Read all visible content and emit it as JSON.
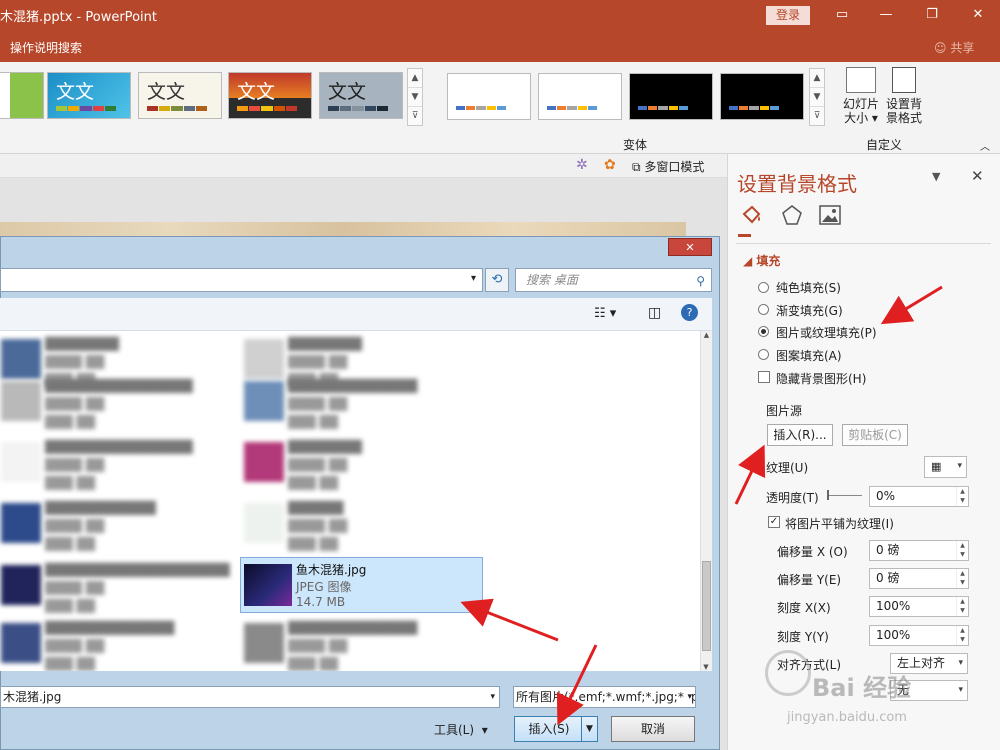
{
  "window": {
    "title": "木混猪.pptx - PowerPoint",
    "login_label": "登录",
    "tell_me": "操作说明搜索",
    "share": "共享"
  },
  "ribbon": {
    "theme_text": "文文",
    "theme_labels": [
      "文文",
      "文文",
      "文文",
      "文文"
    ],
    "variants_label": "变体",
    "customize_label": "自定义",
    "slide_size_label": "幻灯片大小",
    "slide_size_l1": "幻灯片",
    "slide_size_l2": "大小",
    "format_bg_l1": "设置背",
    "format_bg_l2": "景格式"
  },
  "viewbar": {
    "multiwindow": "多窗口模式"
  },
  "pane": {
    "title": "设置背景格式",
    "section_fill": "填充",
    "fill_options": [
      "纯色填充(S)",
      "渐变填充(G)",
      "图片或纹理填充(P)",
      "图案填充(A)"
    ],
    "selected_fill": "图片或纹理填充(P)",
    "hide_bg": "隐藏背景图形(H)",
    "picture_source": "图片源",
    "insert_btn": "插入(R)...",
    "clipboard_btn": "剪贴板(C)",
    "texture": "纹理(U)",
    "transparency": "透明度(T)",
    "transparency_value": "0%",
    "tile_as_texture": "将图片平铺为纹理(I)",
    "offset_x": "偏移量 X (O)",
    "offset_x_value": "0 磅",
    "offset_y": "偏移量 Y(E)",
    "offset_y_value": "0 磅",
    "scale_x": "刻度 X(X)",
    "scale_x_value": "100%",
    "scale_y": "刻度 Y(Y)",
    "scale_y_value": "100%",
    "align": "对齐方式(L)",
    "align_value": "左上对齐",
    "mirror_value": "无"
  },
  "dialog": {
    "search_placeholder": "搜索 桌面",
    "selected_file": {
      "name": "鱼木混猪.jpg",
      "type": "JPEG 图像",
      "size": "14.7 MB"
    },
    "filename_value": "木混猪.jpg",
    "filetype_value": "所有图片(*.emf;*.wmf;*.jpg;*.jp",
    "tools_label": "工具(L)",
    "insert_label": "插入(S)",
    "cancel_label": "取消"
  },
  "watermark": {
    "text": "Bai 经验",
    "url": "jingyan.baidu.com"
  },
  "colors": {
    "accent": "#b7472a",
    "annotation_arrow": "#e02020"
  }
}
